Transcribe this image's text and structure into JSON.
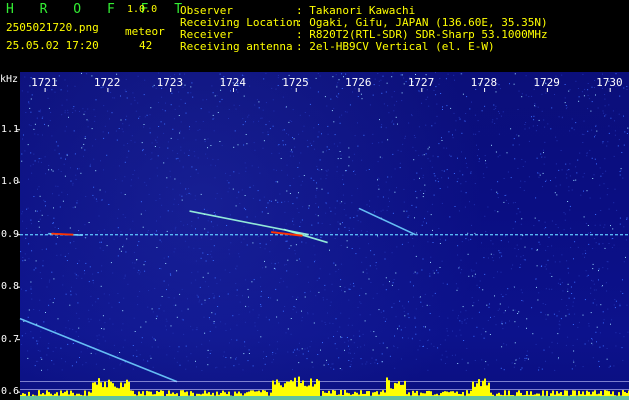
{
  "header": {
    "app_title": "H R O F F T",
    "app_version": "1.0.0",
    "file_name": "2505021720.png",
    "meteor_label": "meteor",
    "date_time": "25.05.02 17:20",
    "meteor_count": "42",
    "info": [
      {
        "label": "Observer",
        "value": ": Takanori Kawachi"
      },
      {
        "label": "Receiving Location",
        "value": ": Ogaki, Gifu, JAPAN (136.60E, 35.35N)"
      },
      {
        "label": "Receiver",
        "value": ": R820T2(RTL-SDR) SDR-Sharp 53.1000MHz"
      },
      {
        "label": "Receiving antenna",
        "value": ": 2el-HB9CV Vertical (el. E-W)"
      }
    ]
  },
  "colors": {
    "background": "#0b0f7a",
    "signal_low": "#00ffff",
    "signal_high": "#ff3300",
    "bar": "#ffff00",
    "text_accent": "#ffff00",
    "title": "#33ee33"
  },
  "chart_data": {
    "type": "heatmap",
    "unit_label": "kHz",
    "x_ticks": [
      "1721",
      "1722",
      "1723",
      "1724",
      "1725",
      "1726",
      "1727",
      "1728",
      "1729",
      "1730"
    ],
    "y_ticks": [
      "1.1",
      "1.0",
      "0.9",
      "0.8",
      "0.7",
      "0.6"
    ],
    "x_range": [
      1720.6,
      1730.3
    ],
    "y_range": [
      0.585,
      1.21
    ],
    "carrier_khz": 0.9,
    "meteor_traces": [
      {
        "x": [
          1721.05,
          1721.6
        ],
        "y": [
          0.902,
          0.899
        ]
      },
      {
        "x": [
          1723.3,
          1725.2
        ],
        "y": [
          0.945,
          0.9
        ]
      },
      {
        "x": [
          1724.8,
          1725.5
        ],
        "y": [
          0.91,
          0.885
        ]
      },
      {
        "x": [
          1726.0,
          1726.9
        ],
        "y": [
          0.95,
          0.9
        ]
      },
      {
        "x": [
          1720.6,
          1723.1
        ],
        "y": [
          0.74,
          0.62
        ]
      }
    ],
    "bottom_lines_khz": [
      0.62,
      0.605
    ]
  }
}
